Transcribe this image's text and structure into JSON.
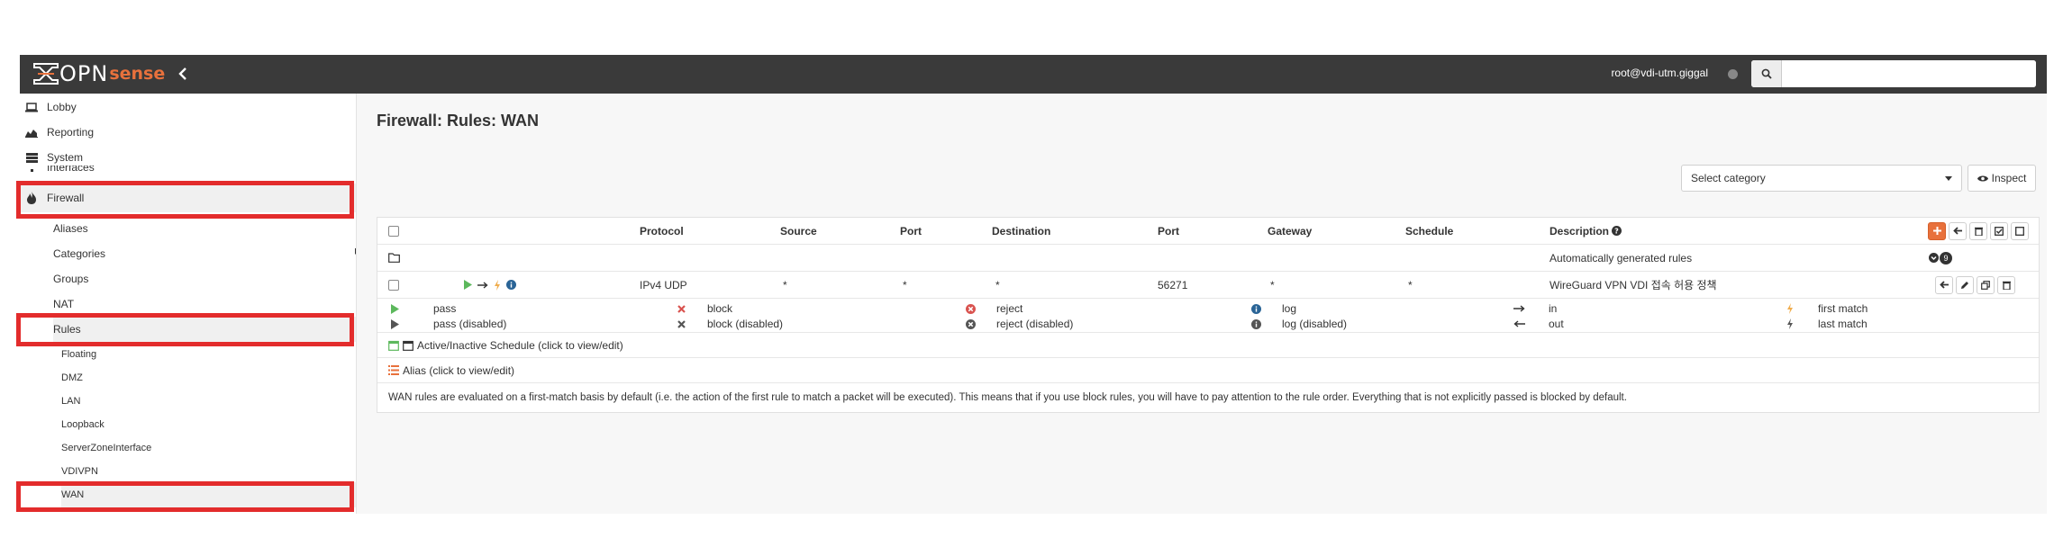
{
  "topbar": {
    "logo_a": "OPN",
    "logo_b": "sense",
    "user": "root@vdi-utm.giggal",
    "search_placeholder": ""
  },
  "sidebar": {
    "items": [
      {
        "label": "Lobby",
        "icon": "laptop-icon"
      },
      {
        "label": "Reporting",
        "icon": "area-chart-icon"
      },
      {
        "label": "System",
        "icon": "server-icon"
      },
      {
        "label": "Interfaces",
        "icon": "sitemap-icon"
      },
      {
        "label": "Firewall",
        "icon": "fire-icon"
      }
    ],
    "firewall_sub": [
      {
        "label": "Aliases",
        "icon": "list-alt-icon"
      },
      {
        "label": "Categories",
        "icon": "tags-icon"
      },
      {
        "label": "Groups",
        "icon": "sitemap-icon"
      },
      {
        "label": "NAT",
        "icon": "exchange-icon"
      },
      {
        "label": "Rules",
        "icon": "check-icon"
      }
    ],
    "rules_sub": [
      "Floating",
      "DMZ",
      "LAN",
      "Loopback",
      "ServerZoneInterface",
      "VDIVPN",
      "WAN"
    ]
  },
  "main": {
    "title": "Firewall: Rules: WAN",
    "category_placeholder": "Select category",
    "inspect_label": "Inspect",
    "columns": [
      "Protocol",
      "Source",
      "Port",
      "Destination",
      "Port",
      "Gateway",
      "Schedule",
      "Description"
    ],
    "auto_row": {
      "description": "Automatically generated rules",
      "count": "9"
    },
    "rule_row": {
      "protocol": "IPv4 UDP",
      "source": "*",
      "source_port": "*",
      "destination": "*",
      "destination_port": "56271",
      "gateway": "*",
      "schedule": "*",
      "description": "WireGuard VPN VDI 접속 허용 정책"
    },
    "legend": {
      "pass": "pass",
      "pass_disabled": "pass (disabled)",
      "block": "block",
      "block_disabled": "block (disabled)",
      "reject": "reject",
      "reject_disabled": "reject (disabled)",
      "log": "log",
      "log_disabled": "log (disabled)",
      "in": "in",
      "out": "out",
      "first_match": "first match",
      "last_match": "last match"
    },
    "schedule_note": "Active/Inactive Schedule (click to view/edit)",
    "alias_note": "Alias (click to view/edit)",
    "info": "WAN rules are evaluated on a first-match basis by default (i.e. the action of the first rule to match a packet will be executed). This means that if you use block rules, you will have to pay attention to the rule order. Everything that is not explicitly passed is blocked by default."
  },
  "colors": {
    "brand_orange": "#e8713c",
    "highlight_red": "#e32c2c",
    "pass_green": "#5cb85c",
    "topbar_bg": "#3a3a3a"
  }
}
